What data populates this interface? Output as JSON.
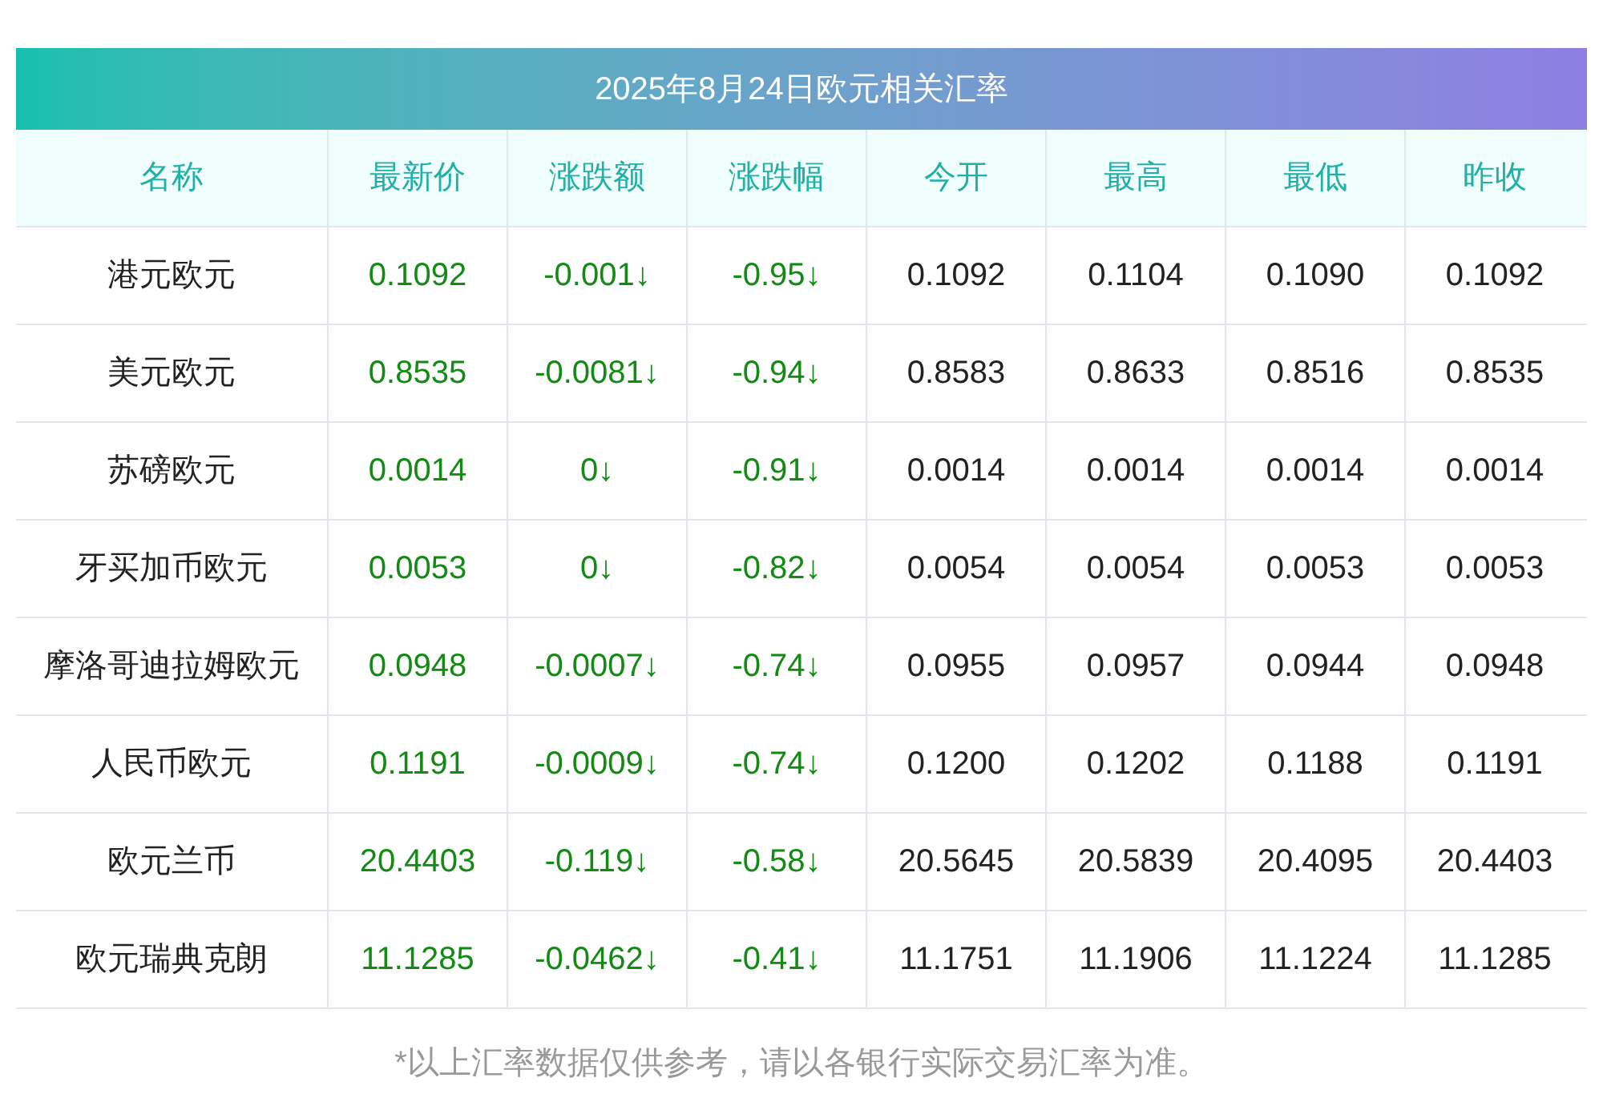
{
  "title": "2025年8月24日欧元相关汇率",
  "columns": [
    {
      "label": "名称",
      "kind": "name"
    },
    {
      "label": "最新价",
      "kind": "change"
    },
    {
      "label": "涨跌额",
      "kind": "change"
    },
    {
      "label": "涨跌幅",
      "kind": "change"
    },
    {
      "label": "今开",
      "kind": "plain"
    },
    {
      "label": "最高",
      "kind": "plain"
    },
    {
      "label": "最低",
      "kind": "plain"
    },
    {
      "label": "昨收",
      "kind": "plain"
    }
  ],
  "rows": [
    [
      "港元欧元",
      "0.1092",
      "-0.001↓",
      "-0.95↓",
      "0.1092",
      "0.1104",
      "0.1090",
      "0.1092"
    ],
    [
      "美元欧元",
      "0.8535",
      "-0.0081↓",
      "-0.94↓",
      "0.8583",
      "0.8633",
      "0.8516",
      "0.8535"
    ],
    [
      "苏磅欧元",
      "0.0014",
      "0↓",
      "-0.91↓",
      "0.0014",
      "0.0014",
      "0.0014",
      "0.0014"
    ],
    [
      "牙买加币欧元",
      "0.0053",
      "0↓",
      "-0.82↓",
      "0.0054",
      "0.0054",
      "0.0053",
      "0.0053"
    ],
    [
      "摩洛哥迪拉姆欧元",
      "0.0948",
      "-0.0007↓",
      "-0.74↓",
      "0.0955",
      "0.0957",
      "0.0944",
      "0.0948"
    ],
    [
      "人民币欧元",
      "0.1191",
      "-0.0009↓",
      "-0.74↓",
      "0.1200",
      "0.1202",
      "0.1188",
      "0.1191"
    ],
    [
      "欧元兰币",
      "20.4403",
      "-0.119↓",
      "-0.58↓",
      "20.5645",
      "20.5839",
      "20.4095",
      "20.4403"
    ],
    [
      "欧元瑞典克朗",
      "11.1285",
      "-0.0462↓",
      "-0.41↓",
      "11.1751",
      "11.1906",
      "11.1224",
      "11.1285"
    ]
  ],
  "footnote": "*以上汇率数据仅供参考，请以各银行实际交易汇率为准。"
}
